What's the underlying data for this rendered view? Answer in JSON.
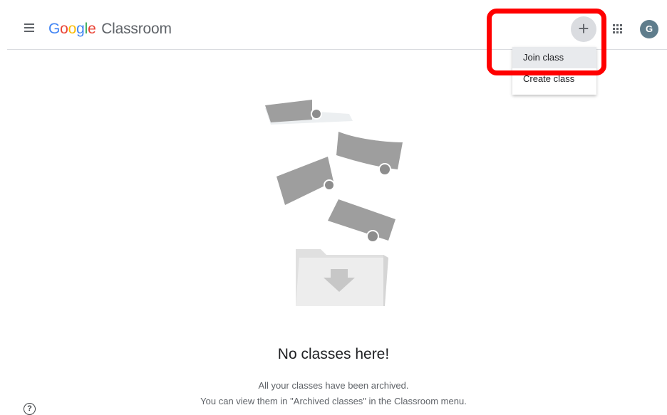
{
  "header": {
    "logo": {
      "g1": "G",
      "o1": "o",
      "o2": "o",
      "g2": "g",
      "l": "l",
      "e": "e",
      "product": "Classroom"
    },
    "plus_label": "+",
    "avatar_letter": "G"
  },
  "add_menu": {
    "items": [
      {
        "label": "Join class",
        "highlighted": true
      },
      {
        "label": "Create class",
        "highlighted": false
      }
    ]
  },
  "empty_state": {
    "title": "No classes here!",
    "line1": "All your classes have been archived.",
    "line2": "You can view them in \"Archived classes\" in the Classroom menu."
  },
  "help_icon_glyph": "?",
  "colors": {
    "google_blue": "#4285f4",
    "google_red": "#ea4335",
    "google_yellow": "#fbbc05",
    "google_green": "#34a853",
    "highlight_frame": "#ff0000",
    "avatar_bg": "#5f7d8c"
  },
  "icons": [
    "menu-icon",
    "plus-icon",
    "apps-grid-icon",
    "help-icon",
    "archive-folder-icon"
  ]
}
